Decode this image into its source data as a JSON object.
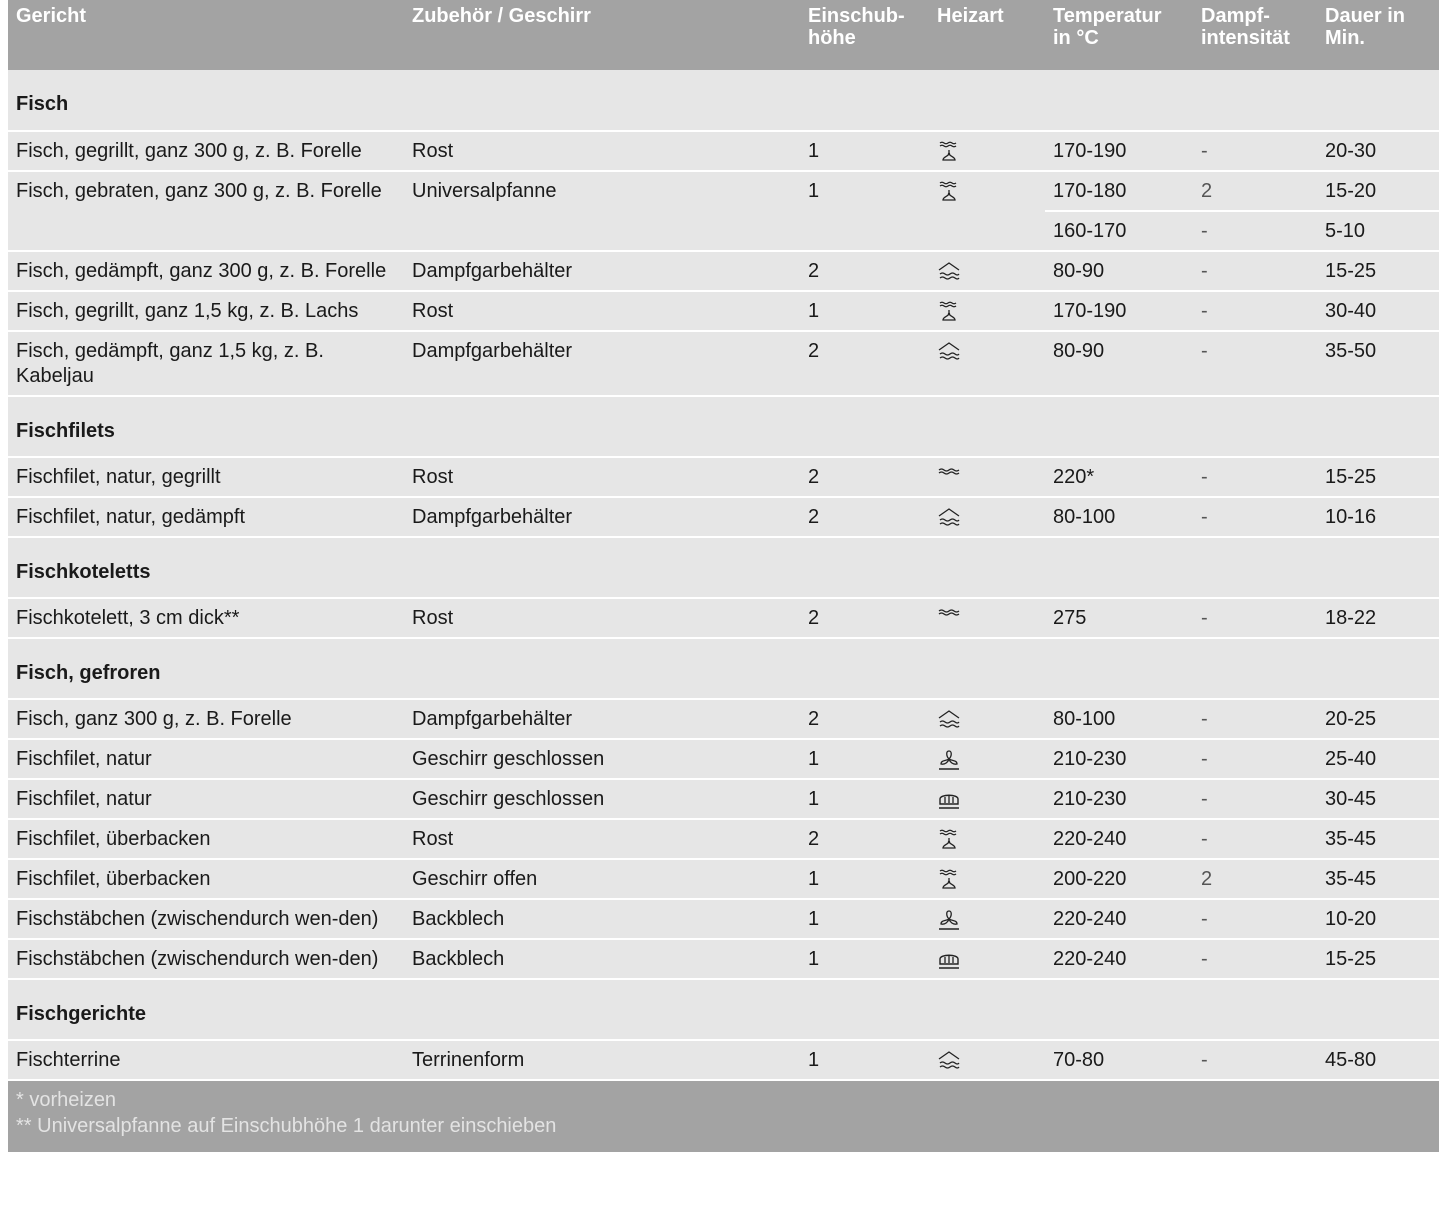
{
  "header": {
    "gericht": "Gericht",
    "zubehoer": "Zubehör / Geschirr",
    "einschub_1": "Einschub-",
    "einschub_2": "höhe",
    "heizart": "Heizart",
    "temperatur_1": "Temperatur",
    "temperatur_2": "in °C",
    "dampf_1": "Dampf-",
    "dampf_2": "intensität",
    "dauer_1": "Dauer in",
    "dauer_2": "Min."
  },
  "sections": [
    {
      "title": "Fisch",
      "rows": [
        {
          "dish": "Fisch, gegrillt, ganz 300 g, z. B. Forelle",
          "acc": "Rost",
          "level": "1",
          "heat": "grill-fan-icon",
          "temp": "170-190",
          "steam": "-",
          "time": "20-30"
        },
        {
          "dish": "Fisch, gebraten, ganz 300 g, z. B. Forelle",
          "acc": "Universalpfanne",
          "level": "1",
          "heat": "grill-fan-icon",
          "temp": "170-180",
          "steam": "2",
          "time": "15-20",
          "temp2": "160-170",
          "steam2": "-",
          "time2": "5-10"
        },
        {
          "dish": "Fisch, gedämpft, ganz 300 g, z. B. Forelle",
          "acc": "Dampfgarbehälter",
          "level": "2",
          "heat": "steam-icon",
          "temp": "80-90",
          "steam": "-",
          "time": "15-25"
        },
        {
          "dish": "Fisch, gegrillt, ganz 1,5 kg, z. B. Lachs",
          "acc": "Rost",
          "level": "1",
          "heat": "grill-fan-icon",
          "temp": "170-190",
          "steam": "-",
          "time": "30-40"
        },
        {
          "dish": "Fisch, gedämpft, ganz 1,5 kg, z. B. Kabeljau",
          "acc": "Dampfgarbehälter",
          "level": "2",
          "heat": "steam-icon",
          "temp": "80-90",
          "steam": "-",
          "time": "35-50"
        }
      ]
    },
    {
      "title": "Fischfilets",
      "rows": [
        {
          "dish": "Fischfilet, natur, gegrillt",
          "acc": "Rost",
          "level": "2",
          "heat": "grill-icon",
          "temp": "220*",
          "steam": "-",
          "time": "15-25"
        },
        {
          "dish": "Fischfilet, natur, gedämpft",
          "acc": "Dampfgarbehälter",
          "level": "2",
          "heat": "steam-icon",
          "temp": "80-100",
          "steam": "-",
          "time": "10-16"
        }
      ]
    },
    {
      "title": "Fischkoteletts",
      "rows": [
        {
          "dish": "Fischkotelett, 3 cm dick**",
          "acc": "Rost",
          "level": "2",
          "heat": "grill-icon",
          "temp": "275",
          "steam": "-",
          "time": "18-22"
        }
      ]
    },
    {
      "title": "Fisch, gefroren",
      "rows": [
        {
          "dish": "Fisch, ganz 300 g, z. B. Forelle",
          "acc": "Dampfgarbehälter",
          "level": "2",
          "heat": "steam-icon",
          "temp": "80-100",
          "steam": "-",
          "time": "20-25"
        },
        {
          "dish": "Fischfilet, natur",
          "acc": "Geschirr geschlossen",
          "level": "1",
          "heat": "fan-icon",
          "temp": "210-230",
          "steam": "-",
          "time": "25-40"
        },
        {
          "dish": "Fischfilet, natur",
          "acc": "Geschirr geschlossen",
          "level": "1",
          "heat": "bread-icon",
          "temp": "210-230",
          "steam": "-",
          "time": "30-45"
        },
        {
          "dish": "Fischfilet, überbacken",
          "acc": "Rost",
          "level": "2",
          "heat": "grill-fan-icon",
          "temp": "220-240",
          "steam": "-",
          "time": "35-45"
        },
        {
          "dish": "Fischfilet, überbacken",
          "acc": "Geschirr offen",
          "level": "1",
          "heat": "grill-fan-icon",
          "temp": "200-220",
          "steam": "2",
          "time": "35-45"
        },
        {
          "dish": "Fischstäbchen (zwischendurch wen-den)",
          "acc": "Backblech",
          "level": "1",
          "heat": "fan-icon",
          "temp": "220-240",
          "steam": "-",
          "time": "10-20"
        },
        {
          "dish": "Fischstäbchen (zwischendurch wen-den)",
          "acc": "Backblech",
          "level": "1",
          "heat": "bread-icon",
          "temp": "220-240",
          "steam": "-",
          "time": "15-25"
        }
      ]
    },
    {
      "title": "Fischgerichte",
      "rows": [
        {
          "dish": "Fischterrine",
          "acc": "Terrinenform",
          "level": "1",
          "heat": "steam-icon",
          "temp": "70-80",
          "steam": "-",
          "time": "45-80"
        }
      ]
    }
  ],
  "footnotes": [
    "* vorheizen",
    "** Universalpfanne auf Einschubhöhe 1 darunter einschieben"
  ]
}
